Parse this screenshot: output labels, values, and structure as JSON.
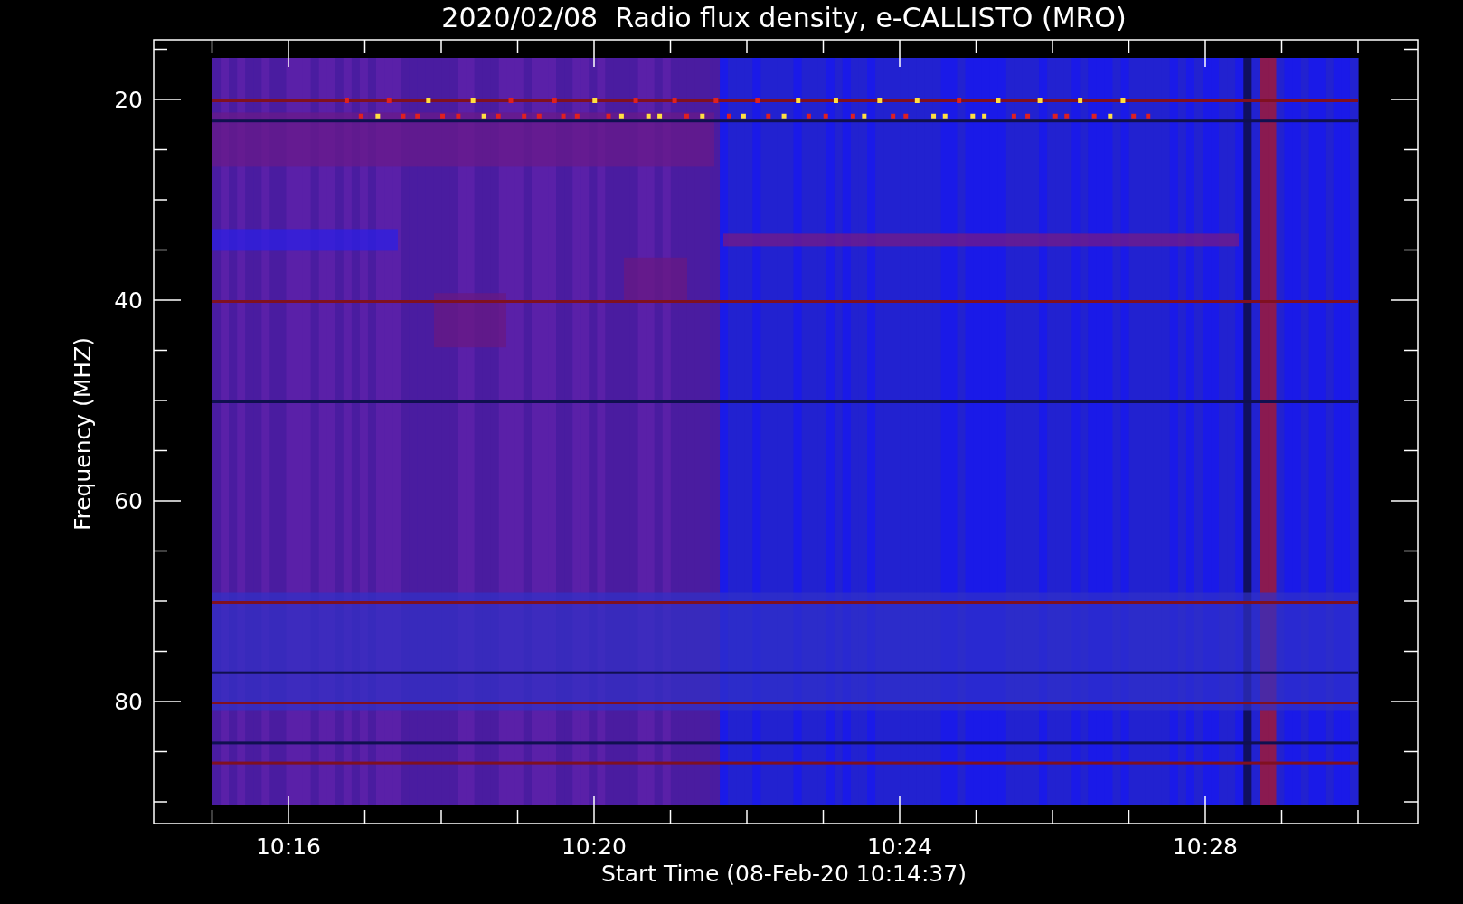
{
  "title": "2020/02/08  Radio flux density, e-CALLISTO (MRO)",
  "y_axis": {
    "label": "Frequency (MHZ)",
    "ticks": [
      "20",
      "40",
      "60",
      "80"
    ]
  },
  "x_axis": {
    "label": "Start Time (08-Feb-20 10:14:37)",
    "ticks": [
      "10:16",
      "10:20",
      "10:24",
      "10:28"
    ]
  }
}
